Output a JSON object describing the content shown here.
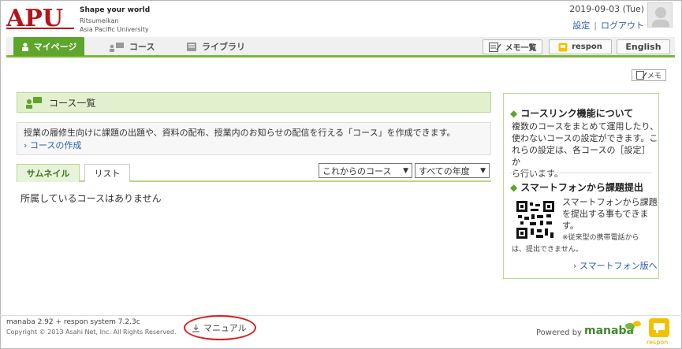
{
  "colors": {
    "accent": "#5ea52b",
    "brand_red": "#b5141c",
    "link": "#2a5caa",
    "highlight_ring": "#d81e1e"
  },
  "header": {
    "logo_mark": "APU",
    "tagline": "Shape your world",
    "org_line1": "Ritsumeikan",
    "org_line2": "Asia Pacific University",
    "date": "2019-09-03 (Tue)",
    "settings_link": "設定",
    "logout_link": "ログアウト",
    "avatar_icon": "user-avatar-icon"
  },
  "nav": {
    "mypage": "マイページ",
    "course": "コース",
    "library": "ライブラリ",
    "memo_list": "メモ一覧",
    "respon": "respon",
    "language": "English"
  },
  "main": {
    "memo_label": "メモ",
    "section_title": "コース一覧",
    "info_text": "授業の履修生向けに課題の出題や、資料の配布、授業内のお知らせの配信を行える「コース」を作成できます。",
    "create_course_link": "コースの作成",
    "tab_thumbnail": "サムネイル",
    "tab_list": "リスト",
    "filter_course": "これからのコース",
    "filter_year": "すべての年度",
    "empty_message": "所属しているコースはありません"
  },
  "sidebar": {
    "course_link_title": "コースリンク機能について",
    "course_link_text_1": "複数のコースをまとめて運用したり、",
    "course_link_text_2": "使わないコースの設定ができます。こ",
    "course_link_text_3": "れらの設定は、各コースの［設定］か",
    "course_link_text_4": "ら行います。",
    "smartphone_title": "スマートフォンから課題提出",
    "smartphone_text_1": "スマートフォンから課題",
    "smartphone_text_2": "を提出する事もできま",
    "smartphone_text_3": "す。",
    "note_1": "※従来型の携帯電話から",
    "note_2": "は、提出できません。",
    "smartphone_link": "スマートフォン版へ"
  },
  "footer": {
    "version": "manaba 2.92 + respon system 7.2.3c",
    "copyright": "Copyright © 2013 Asahi Net, Inc. All Rights Reserved.",
    "manual": "マニュアル",
    "powered_by": "Powered by",
    "manaba_logo": "manaba",
    "respon_logo": "respon"
  }
}
